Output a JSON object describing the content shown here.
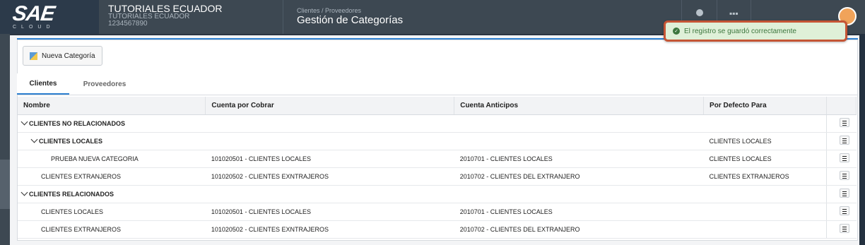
{
  "brand": {
    "logo": "SAE",
    "logo_sub": "CLOUD"
  },
  "company": {
    "name": "TUTORIALES ECUADOR",
    "sub1": "TUTORIALES ECUADOR",
    "ruc": "1234567890"
  },
  "breadcrumb": {
    "path": "Clientes / Proveedores",
    "title": "Gestión de Categorías"
  },
  "toolbar": {
    "new_label": "Nueva Categoría"
  },
  "tabs": [
    {
      "label": "Clientes"
    },
    {
      "label": "Proveedores"
    }
  ],
  "toast": {
    "message": "El registro se guardó correctamente"
  },
  "table": {
    "headers": [
      "Nombre",
      "Cuenta por Cobrar",
      "Cuenta Anticipos",
      "Por Defecto Para"
    ],
    "rows": [
      {
        "name": "CLIENTES NO RELACIONADOS",
        "cobrar": "",
        "anticipos": "",
        "defecto": ""
      },
      {
        "name": "CLIENTES LOCALES",
        "cobrar": "",
        "anticipos": "",
        "defecto": "CLIENTES LOCALES"
      },
      {
        "name": "PRUEBA NUEVA CATEGORIA",
        "cobrar": "101020501 - CLIENTES LOCALES",
        "anticipos": "2010701 - CLIENTES LOCALES",
        "defecto": "CLIENTES LOCALES"
      },
      {
        "name": "CLIENTES EXTRANJEROS",
        "cobrar": "101020502 - CLIENTES EXNTRAJEROS",
        "anticipos": "2010702 - CLIENTES DEL EXTRANJERO",
        "defecto": "CLIENTES EXTRANJEROS"
      },
      {
        "name": "CLIENTES RELACIONADOS",
        "cobrar": "",
        "anticipos": "",
        "defecto": ""
      },
      {
        "name": "CLIENTES LOCALES",
        "cobrar": "101020501 - CLIENTES LOCALES",
        "anticipos": "2010701 - CLIENTES LOCALES",
        "defecto": ""
      },
      {
        "name": "CLIENTES EXTRANJEROS",
        "cobrar": "101020502 - CLIENTES EXNTRAJEROS",
        "anticipos": "2010702 - CLIENTES DEL EXTRANJERO",
        "defecto": ""
      }
    ]
  },
  "colors": {
    "topbar": "#3d4852",
    "accent": "#2d7fd0",
    "toast_bg": "#dff0d8",
    "toast_border": "#c55535"
  }
}
